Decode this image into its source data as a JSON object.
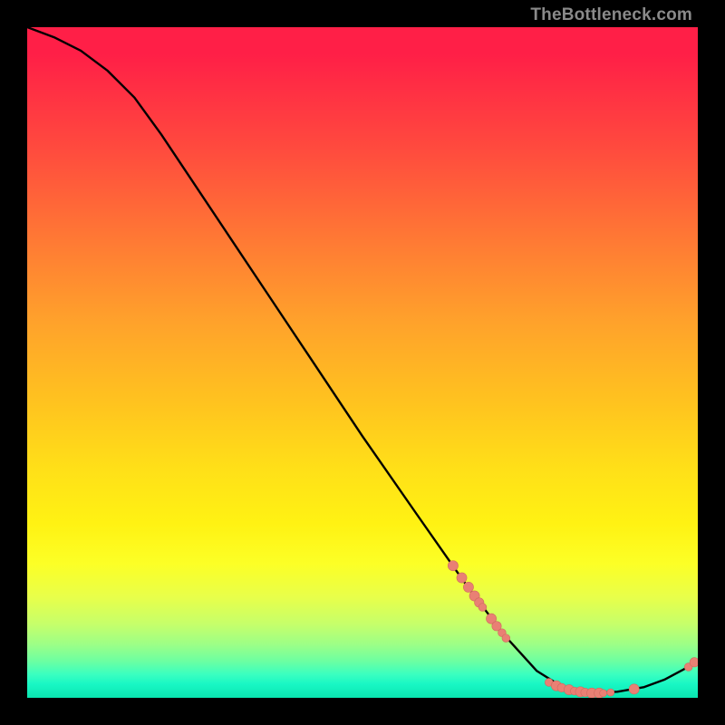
{
  "watermark": "TheBottleneck.com",
  "colors": {
    "curve": "#000000",
    "point_fill": "#e98074",
    "point_stroke": "#d06a5f",
    "frame": "#000000"
  },
  "chart_data": {
    "type": "line",
    "title": "",
    "xlabel": "",
    "ylabel": "",
    "xlim": [
      0,
      100
    ],
    "ylim": [
      0,
      100
    ],
    "curve": [
      {
        "x": 0,
        "y": 100
      },
      {
        "x": 4,
        "y": 98.5
      },
      {
        "x": 8,
        "y": 96.5
      },
      {
        "x": 12,
        "y": 93.5
      },
      {
        "x": 16,
        "y": 89.5
      },
      {
        "x": 20,
        "y": 84
      },
      {
        "x": 24,
        "y": 78
      },
      {
        "x": 30,
        "y": 69
      },
      {
        "x": 36,
        "y": 60
      },
      {
        "x": 42,
        "y": 51
      },
      {
        "x": 50,
        "y": 39
      },
      {
        "x": 58,
        "y": 27.5
      },
      {
        "x": 65,
        "y": 17.5
      },
      {
        "x": 71,
        "y": 9.5
      },
      {
        "x": 76,
        "y": 4
      },
      {
        "x": 80,
        "y": 1.5
      },
      {
        "x": 84,
        "y": 0.7
      },
      {
        "x": 88,
        "y": 0.9
      },
      {
        "x": 92,
        "y": 1.6
      },
      {
        "x": 95,
        "y": 2.7
      },
      {
        "x": 98,
        "y": 4.3
      },
      {
        "x": 100,
        "y": 5.6
      }
    ],
    "points": [
      {
        "x": 63.5,
        "y": 19.7,
        "r": 5.6
      },
      {
        "x": 64.8,
        "y": 17.9,
        "r": 5.6
      },
      {
        "x": 65.8,
        "y": 16.5,
        "r": 5.6
      },
      {
        "x": 66.7,
        "y": 15.2,
        "r": 5.6
      },
      {
        "x": 67.4,
        "y": 14.2,
        "r": 5.2
      },
      {
        "x": 67.9,
        "y": 13.5,
        "r": 4.4
      },
      {
        "x": 69.2,
        "y": 11.8,
        "r": 5.6
      },
      {
        "x": 70.0,
        "y": 10.7,
        "r": 5.2
      },
      {
        "x": 70.8,
        "y": 9.7,
        "r": 4.4
      },
      {
        "x": 71.4,
        "y": 8.9,
        "r": 4.4
      },
      {
        "x": 77.8,
        "y": 2.3,
        "r": 4.4
      },
      {
        "x": 78.9,
        "y": 1.8,
        "r": 5.6
      },
      {
        "x": 79.7,
        "y": 1.5,
        "r": 4.8
      },
      {
        "x": 80.8,
        "y": 1.2,
        "r": 5.6
      },
      {
        "x": 81.6,
        "y": 1.0,
        "r": 4.4
      },
      {
        "x": 82.5,
        "y": 0.9,
        "r": 5.6
      },
      {
        "x": 83.2,
        "y": 0.8,
        "r": 4.8
      },
      {
        "x": 84.2,
        "y": 0.7,
        "r": 5.6
      },
      {
        "x": 85.3,
        "y": 0.7,
        "r": 5.6
      },
      {
        "x": 85.9,
        "y": 0.7,
        "r": 4.0
      },
      {
        "x": 87.0,
        "y": 0.8,
        "r": 4.0
      },
      {
        "x": 90.5,
        "y": 1.3,
        "r": 5.6
      },
      {
        "x": 98.6,
        "y": 4.6,
        "r": 4.4
      },
      {
        "x": 99.5,
        "y": 5.3,
        "r": 5.2
      }
    ]
  }
}
